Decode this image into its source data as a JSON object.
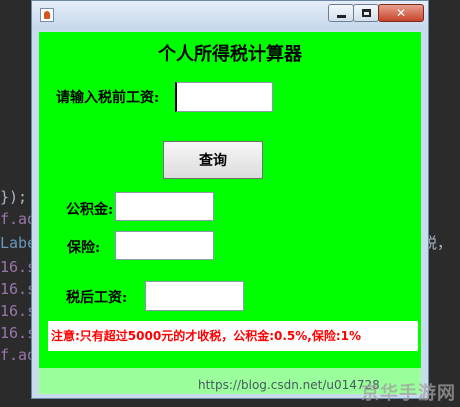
{
  "editor": {
    "lines": [
      "f.ad",
      "Labe",
      "16.s",
      "16.s",
      "16.s",
      "16.s",
      "f.ad"
    ],
    "brace_line": "});",
    "right_fragment": "税，"
  },
  "window": {
    "title": "",
    "heading": "个人所得税计算器",
    "controls": {
      "minimize": "minimize",
      "maximize": "maximize",
      "close": "✕"
    }
  },
  "form": {
    "salary_label": "请输入税前工资:",
    "salary_value": "",
    "query_button": "查询",
    "fund_label": "公积金:",
    "fund_value": "",
    "insurance_label": "保险:",
    "insurance_value": "",
    "net_label": "税后工资:",
    "net_value": ""
  },
  "notice": "注意:只有超过5000元的才收税，公积金:0.5%,保险:1%",
  "watermark": "https://blog.csdn.net/u014728",
  "watermark_site": "京华手游网",
  "colors": {
    "content_bg": "#00ff00",
    "notice_text": "#ff0000"
  }
}
